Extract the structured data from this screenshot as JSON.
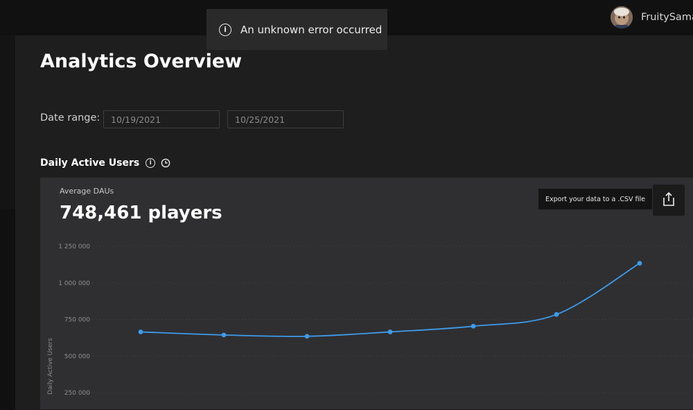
{
  "notification": {
    "message": "An unknown error occurred",
    "icon": "info-icon"
  },
  "user": {
    "name": "FruitySama"
  },
  "page": {
    "title": "Analytics Overview"
  },
  "date_range": {
    "label": "Date range:",
    "from": "10/19/2021",
    "to": "10/25/2021"
  },
  "section": {
    "title": "Daily Active Users"
  },
  "summary": {
    "label": "Average DAUs",
    "value": "748,461 players"
  },
  "export": {
    "tooltip": "Export your data to a .CSV file",
    "icon": "export-icon"
  },
  "colors": {
    "line": "#3d9be9",
    "background": "#2f2f31"
  },
  "chart_data": {
    "type": "line",
    "ylabel": "Daily Active Users",
    "ylim": [
      250000,
      1250000
    ],
    "y_ticks": [
      1250000,
      1000000,
      750000,
      500000,
      250000
    ],
    "y_tick_labels": [
      "1 250 000",
      "1 000 000",
      "750 000",
      "500 000",
      "250 000"
    ],
    "grid": true,
    "series": [
      {
        "values": [
          665000,
          644000,
          635000,
          665000,
          704000,
          784000,
          1134000
        ]
      }
    ]
  }
}
